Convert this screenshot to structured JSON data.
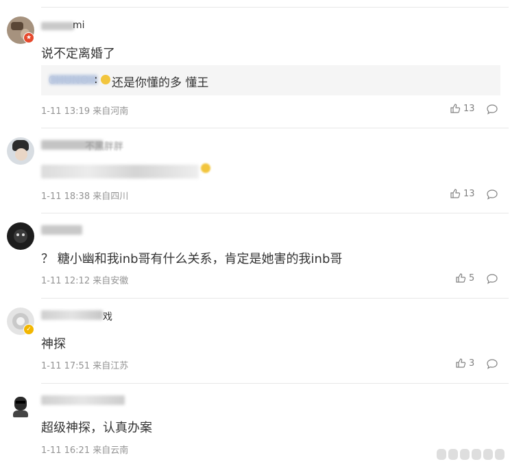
{
  "comments": [
    {
      "name": "mi",
      "text": "说不定离婚了",
      "reply": {
        "author": "CHUNO",
        "sep": ":",
        "text": "还是你懂的多 懂王"
      },
      "time": "1-11 13:19",
      "location": "来自河南",
      "likes": "13",
      "badge_icon": "star-badge-icon"
    },
    {
      "name": "不黑胖胖",
      "text": "",
      "time": "1-11 18:38",
      "location": "来自四川",
      "likes": "13"
    },
    {
      "name": "",
      "text": "？ 糖小幽和我inb哥有什么关系，肯定是她害的我inb哥",
      "time": "1-11 12:12",
      "location": "来自安徽",
      "likes": "5"
    },
    {
      "name": "戏",
      "text": "神探",
      "time": "1-11 17:51",
      "location": "来自江苏",
      "likes": "3",
      "badge_icon": "verified-badge-icon"
    },
    {
      "name": "",
      "text": "超级神探，认真办案",
      "time": "1-11 16:21",
      "location": "来自云南",
      "likes": ""
    }
  ],
  "colors": {
    "text": "#333333",
    "meta": "#939393",
    "reply_bg": "#f5f5f5",
    "divider": "#e7e7e7",
    "badge_red": "#e6492c",
    "badge_gold": "#f2b600"
  }
}
